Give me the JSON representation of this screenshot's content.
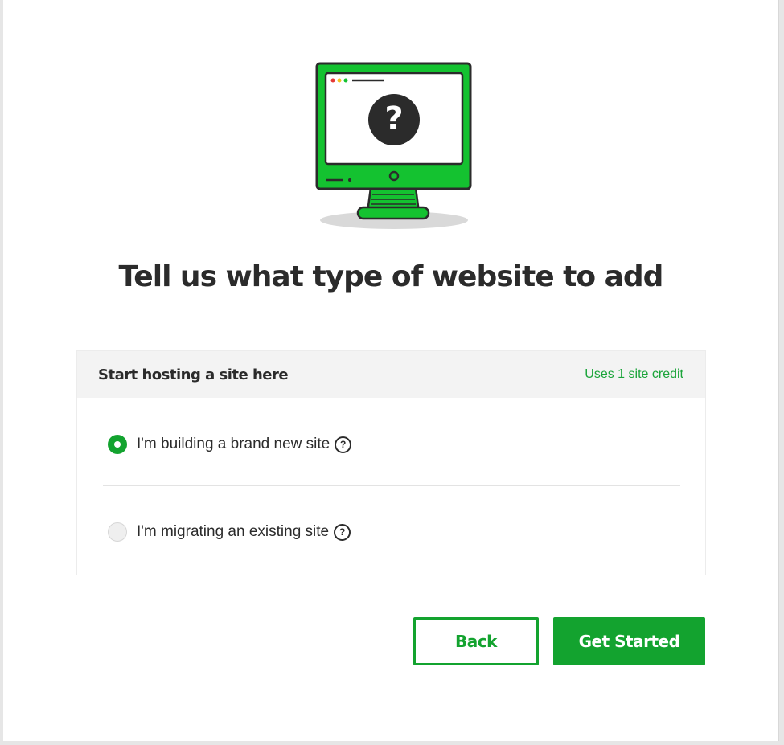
{
  "page": {
    "title": "Tell us what type of website to add"
  },
  "panel": {
    "header_title": "Start hosting a site here",
    "header_credit": "Uses 1 site credit",
    "options": [
      {
        "label": "I'm building a brand new site",
        "selected": true
      },
      {
        "label": "I'm migrating an existing site",
        "selected": false
      }
    ],
    "help_glyph": "?"
  },
  "illustration": {
    "question_glyph": "?"
  },
  "buttons": {
    "back_label": "Back",
    "start_label": "Get Started"
  },
  "colors": {
    "accent": "#13a32f",
    "monitor_green": "#14c230",
    "text": "#2b2b2b"
  },
  "icons": {
    "illustration": "monitor-question-icon",
    "help": "help-circle-icon",
    "radio_on": "radio-checked",
    "radio_off": "radio-unchecked"
  }
}
